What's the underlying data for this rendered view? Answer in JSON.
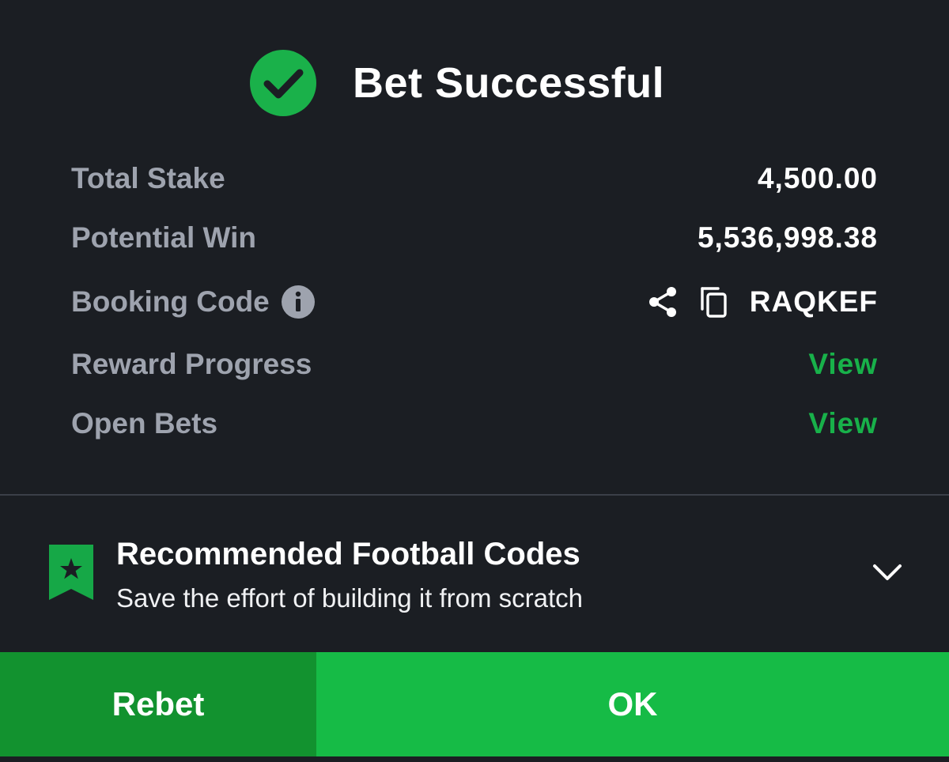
{
  "header": {
    "title": "Bet Successful",
    "icon": "check-circle-icon"
  },
  "summary": {
    "total_stake": {
      "label": "Total Stake",
      "value": "4,500.00"
    },
    "potential_win": {
      "label": "Potential Win",
      "value": "5,536,998.38"
    },
    "booking_code": {
      "label": "Booking Code",
      "code": "RAQKEF",
      "info_icon": "info-icon",
      "share_icon": "share-icon",
      "copy_icon": "copy-icon"
    },
    "reward_progress": {
      "label": "Reward Progress",
      "link": "View"
    },
    "open_bets": {
      "label": "Open Bets",
      "link": "View"
    }
  },
  "recommended": {
    "icon": "bookmark-star-icon",
    "title": "Recommended Football Codes",
    "subtitle": "Save the effort of building it from scratch",
    "expand_icon": "chevron-down-icon"
  },
  "footer": {
    "rebet_label": "Rebet",
    "ok_label": "OK"
  },
  "colors": {
    "background": "#1b1e23",
    "accent_green": "#16bb46",
    "dark_green": "#12922f",
    "link_green": "#18b14a",
    "label_gray": "#9ea3ae"
  }
}
